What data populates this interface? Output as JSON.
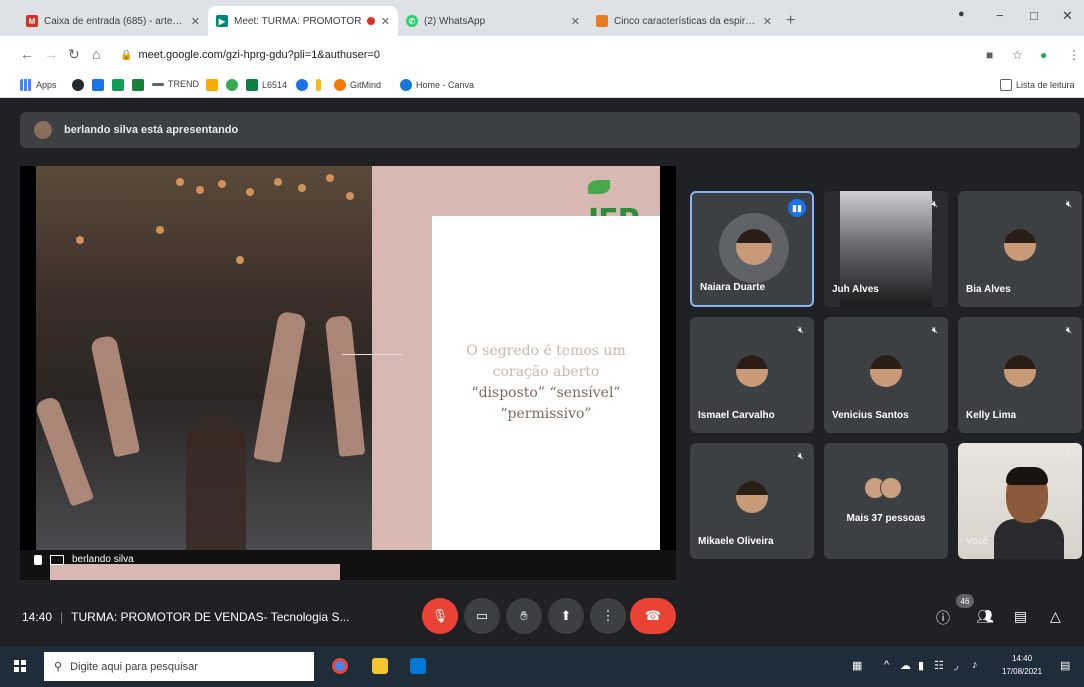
{
  "browser": {
    "tabs": [
      {
        "title": "Caixa de entrada (685) - arte.edu.",
        "favicon": "gmail-icon",
        "color": "#d93025"
      },
      {
        "title": "Meet: TURMA: PROMOTOR",
        "favicon": "meet-icon",
        "color": "#00897b",
        "active": true
      },
      {
        "title": "(2) WhatsApp",
        "favicon": "whatsapp-icon",
        "color": "#25d366"
      },
      {
        "title": "Cinco características da espiritua",
        "favicon": "site-icon",
        "color": "#e67c22"
      }
    ],
    "url": "meet.google.com/gzi-hprg-gdu?pli=1&authuser=0",
    "bookmarks": [
      {
        "label": "Apps"
      },
      {
        "label": "TREND"
      },
      {
        "label": "L6514"
      },
      {
        "label": "GitMind"
      },
      {
        "label": "Home - Canva"
      }
    ],
    "reading_list": "Lista de leitura"
  },
  "meet": {
    "presenter_banner": "berlando silva está apresentando",
    "slide": {
      "line1": "O segredo é temos um",
      "line2": "coração aberto",
      "line3": "“disposto” “sensível”",
      "line4": "“permissivo”",
      "logo": "IEP"
    },
    "presenter_name": "berlando silva",
    "participants": [
      {
        "name": "Naiara Duarte",
        "speaking": true
      },
      {
        "name": "Juh Alves"
      },
      {
        "name": "Bia Alves"
      },
      {
        "name": "Ismael Carvalho"
      },
      {
        "name": "Venicius Santos"
      },
      {
        "name": "Kelly Lima"
      },
      {
        "name": "Mikaele Oliveira"
      },
      {
        "name": "Mais 37 pessoas"
      },
      {
        "name": "Você"
      }
    ],
    "time": "14:40",
    "meeting_title": "TURMA: PROMOTOR DE VENDAS- Tecnologia S...",
    "participant_count": "46"
  },
  "taskbar": {
    "search_placeholder": "Digite aqui para pesquisar",
    "time": "14:40",
    "date": "17/08/2021"
  }
}
